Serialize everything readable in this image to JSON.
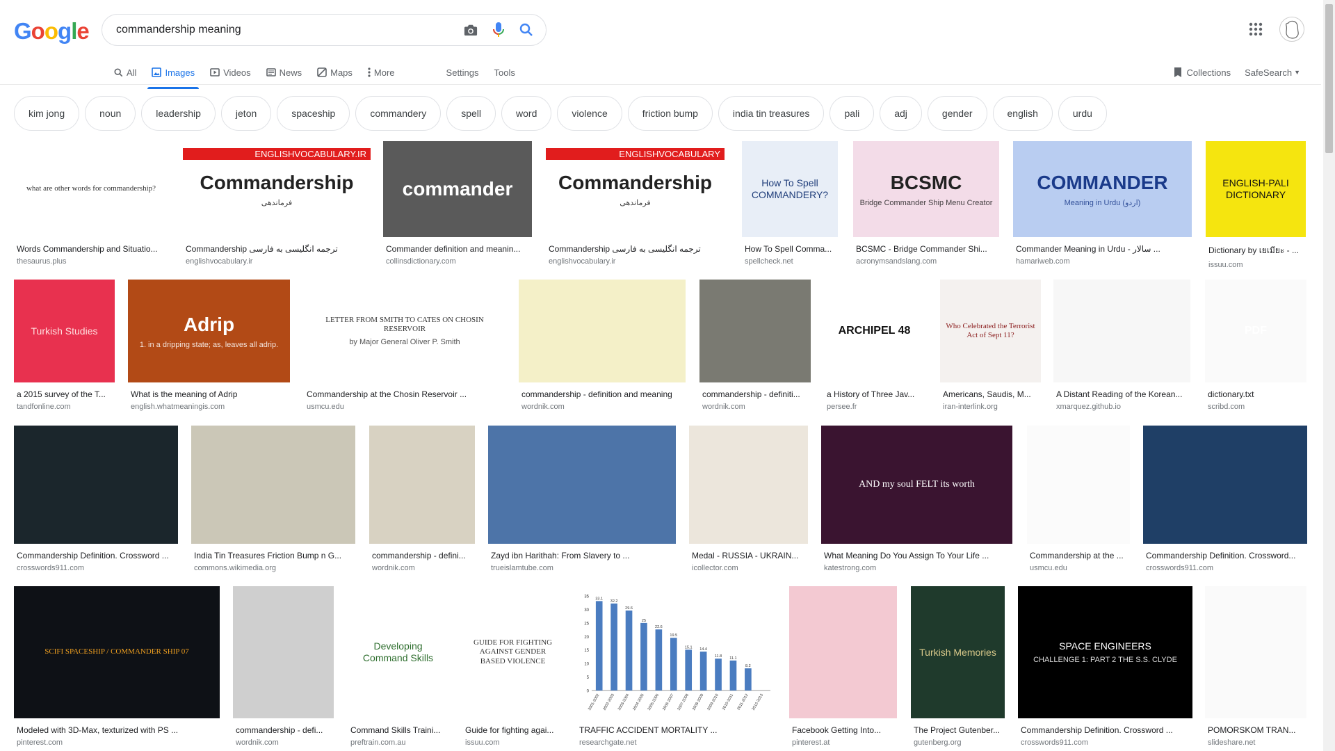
{
  "logo": {
    "letters": [
      "G",
      "o",
      "o",
      "g",
      "l",
      "e"
    ],
    "colors": [
      "#4285F4",
      "#EA4335",
      "#FBBC05",
      "#4285F4",
      "#34A853",
      "#EA4335"
    ]
  },
  "search": {
    "query": "commandership meaning"
  },
  "nav": {
    "tabs": [
      {
        "label": "All",
        "icon": "search-icon"
      },
      {
        "label": "Images",
        "icon": "image-icon",
        "active": true
      },
      {
        "label": "Videos",
        "icon": "video-icon"
      },
      {
        "label": "News",
        "icon": "news-icon"
      },
      {
        "label": "Maps",
        "icon": "maps-icon"
      },
      {
        "label": "More",
        "icon": "more-vert-icon"
      }
    ],
    "settings": "Settings",
    "tools": "Tools",
    "collections": "Collections",
    "safesearch": "SafeSearch"
  },
  "chips": [
    "kim jong",
    "noun",
    "leadership",
    "jeton",
    "spaceship",
    "commandery",
    "spell",
    "word",
    "violence",
    "friction bump",
    "india tin treasures",
    "pali",
    "adj",
    "gender",
    "english",
    "urdu"
  ],
  "rows": [
    [
      {
        "caption": "Words Commandership and Situatio...",
        "source": "thesaurus.plus",
        "thumb_text": "what are other words for commandership?",
        "bg": "#ffffff",
        "fg": "#333333"
      },
      {
        "caption": "Commandership ترجمه انگلیسی به فارسی",
        "source": "englishvocabulary.ir",
        "thumb_text": "Commandership",
        "thumb_banner": "ENGLISHVOCABULARY.IR",
        "thumb_sub": "فرماندهی",
        "bg": "#ffffff",
        "fg": "#222222"
      },
      {
        "caption": "Commander definition and meanin...",
        "source": "collinsdictionary.com",
        "thumb_text": "commander",
        "bg": "#5a5a5a",
        "fg": "#ffffff"
      },
      {
        "caption": "Commandership ترجمه انگلیسی به فارسی",
        "source": "englishvocabulary.ir",
        "thumb_text": "Commandership",
        "thumb_banner": "ENGLISHVOCABULARY",
        "thumb_sub": "فرماندهی",
        "bg": "#ffffff",
        "fg": "#222222"
      },
      {
        "caption": "How To Spell Comma...",
        "source": "spellcheck.net",
        "thumb_text": "How To Spell COMMANDERY?",
        "bg": "#e8eef7",
        "fg": "#1f3d7a"
      },
      {
        "caption": "BCSMC - Bridge Commander Shi...",
        "source": "acronymsandslang.com",
        "thumb_text": "BCSMC",
        "thumb_sub": "Bridge Commander Ship Menu Creator",
        "bg": "#f3dce8",
        "fg": "#222222"
      },
      {
        "caption": "Commander Meaning in Urdu - سالار ...",
        "source": "hamariweb.com",
        "thumb_text": "COMMANDER",
        "thumb_sub": "Meaning in Urdu (اردو)",
        "bg": "#b9cdf1",
        "fg": "#1a3a8a"
      },
      {
        "caption": "Dictionary by เยเมียะ - ...",
        "source": "issuu.com",
        "thumb_text": "ENGLISH-PALI DICTIONARY",
        "bg": "#f5e50f",
        "fg": "#111111"
      }
    ],
    [
      {
        "caption": "a 2015 survey of the T...",
        "source": "tandfonline.com",
        "thumb_text": "Turkish Studies",
        "bg": "#e8314f",
        "fg": "#ffe0e0"
      },
      {
        "caption": "What is the meaning of Adrip",
        "source": "english.whatmeaningis.com",
        "thumb_text": "Adrip",
        "thumb_sub": "1. in a dripping state; as, leaves all adrip.",
        "bg": "#b24a16",
        "fg": "#ffffff"
      },
      {
        "caption": "Commandership at the Chosin Reservoir ...",
        "source": "usmcu.edu",
        "thumb_text": "LETTER FROM SMITH TO CATES ON CHOSIN RESERVOIR",
        "thumb_sub": "by Major General Oliver P. Smith",
        "bg": "#ffffff",
        "fg": "#333333"
      },
      {
        "caption": "commandership - definition and meaning",
        "source": "wordnik.com",
        "thumb_text": "",
        "bg": "#f4f0c8",
        "fg": "#333333"
      },
      {
        "caption": "commandership - definiti...",
        "source": "wordnik.com",
        "thumb_text": "",
        "bg": "#7a7a72",
        "fg": "#ffffff"
      },
      {
        "caption": "a History of Three Jav...",
        "source": "persee.fr",
        "thumb_text": "ARCHIPEL 48",
        "bg": "#ffffff",
        "fg": "#111111"
      },
      {
        "caption": "Americans, Saudis, M...",
        "source": "iran-interlink.org",
        "thumb_text": "Who Celebrated the Terrorist Act of Sept 11?",
        "bg": "#f4f1ef",
        "fg": "#8a1c1c"
      },
      {
        "caption": "A Distant Reading of the Korean...",
        "source": "xmarquez.github.io",
        "thumb_text": "",
        "bg": "#f7f7f7",
        "fg": "#333333"
      },
      {
        "caption": "dictionary.txt",
        "source": "scribd.com",
        "thumb_text": "PDF",
        "bg": "#fafafa",
        "fg": "#ffffff"
      }
    ],
    [
      {
        "caption": "Commandership Definition. Crossword ...",
        "source": "crosswords911.com",
        "thumb_text": "",
        "bg": "#1b262c",
        "fg": "#ffffff"
      },
      {
        "caption": "India Tin Treasures Friction Bump n G...",
        "source": "commons.wikimedia.org",
        "thumb_text": "",
        "bg": "#cbc7b7",
        "fg": "#ffffff"
      },
      {
        "caption": "commandership - defini...",
        "source": "wordnik.com",
        "thumb_text": "",
        "bg": "#d8d2c2",
        "fg": "#222222"
      },
      {
        "caption": "Zayd ibn Harithah: From Slavery to ...",
        "source": "trueislamtube.com",
        "thumb_text": "",
        "bg": "#4d74a8",
        "fg": "#ffffff"
      },
      {
        "caption": "Medal - RUSSIA - UKRAIN...",
        "source": "icollector.com",
        "thumb_text": "",
        "bg": "#ece6dc",
        "fg": "#333333"
      },
      {
        "caption": "What Meaning Do You Assign To Your Life ...",
        "source": "katestrong.com",
        "thumb_text": "AND my soul FELT its worth",
        "bg": "#3a1430",
        "fg": "#ffffff"
      },
      {
        "caption": "Commandership at the ...",
        "source": "usmcu.edu",
        "thumb_text": "",
        "bg": "#fbfbfb",
        "fg": "#999999"
      },
      {
        "caption": "Commandership Definition. Crossword...",
        "source": "crosswords911.com",
        "thumb_text": "",
        "bg": "#1f3f66",
        "fg": "#ffffff"
      }
    ],
    [
      {
        "caption": "Modeled with 3D-Max, texturized with PS ...",
        "source": "pinterest.com",
        "thumb_text": "SCIFI SPACESHIP / COMMANDER SHIP 07",
        "bg": "#0e1116",
        "fg": "#f0a020"
      },
      {
        "caption": "commandership - defi...",
        "source": "wordnik.com",
        "thumb_text": "",
        "bg": "#cfcfcf",
        "fg": "#222222"
      },
      {
        "caption": "Command Skills Traini...",
        "source": "preftrain.com.au",
        "thumb_text": "Developing Command Skills",
        "bg": "#ffffff",
        "fg": "#2e6e2e"
      },
      {
        "caption": "Guide for fighting agai...",
        "source": "issuu.com",
        "thumb_text": "GUIDE FOR FIGHTING AGAINST GENDER BASED VIOLENCE",
        "bg": "#ffffff",
        "fg": "#333333"
      },
      {
        "caption": "TRAFFIC ACCIDENT MORTALITY ...",
        "source": "researchgate.net",
        "thumb_text": "",
        "bg": "#ffffff",
        "fg": "#333333"
      },
      {
        "caption": "Facebook Getting Into...",
        "source": "pinterest.at",
        "thumb_text": "",
        "bg": "#f3c9d2",
        "fg": "#333333"
      },
      {
        "caption": "The Project Gutenber...",
        "source": "gutenberg.org",
        "thumb_text": "Turkish Memories",
        "bg": "#1f3a2c",
        "fg": "#d9c98a"
      },
      {
        "caption": "Commandership Definition. Crossword ...",
        "source": "crosswords911.com",
        "thumb_text": "SPACE ENGINEERS",
        "thumb_sub": "CHALLENGE 1: PART 2 THE S.S. CLYDE",
        "bg": "#000000",
        "fg": "#ffffff"
      },
      {
        "caption": "POMORSKOM TRAN...",
        "source": "slideshare.net",
        "thumb_text": "",
        "bg": "#fafafa",
        "fg": "#555555"
      }
    ]
  ],
  "mortality_chart": {
    "type": "bar",
    "categories": [
      "2001-2002",
      "2002-2003",
      "2003-2004",
      "2004-2005",
      "2005-2006",
      "2006-2007",
      "2007-2008",
      "2008-2009",
      "2009-2010",
      "2010-2011",
      "2011-2012",
      "2012-2013"
    ],
    "values": [
      33.1,
      32.2,
      29.6,
      25,
      22.6,
      19.5,
      15.1,
      14.4,
      11.8,
      11.1,
      8.2
    ],
    "ylim": [
      0,
      35
    ],
    "ticks": [
      0,
      5,
      10,
      15,
      20,
      25,
      30,
      35
    ],
    "bar_color": "#4a7cc0"
  }
}
